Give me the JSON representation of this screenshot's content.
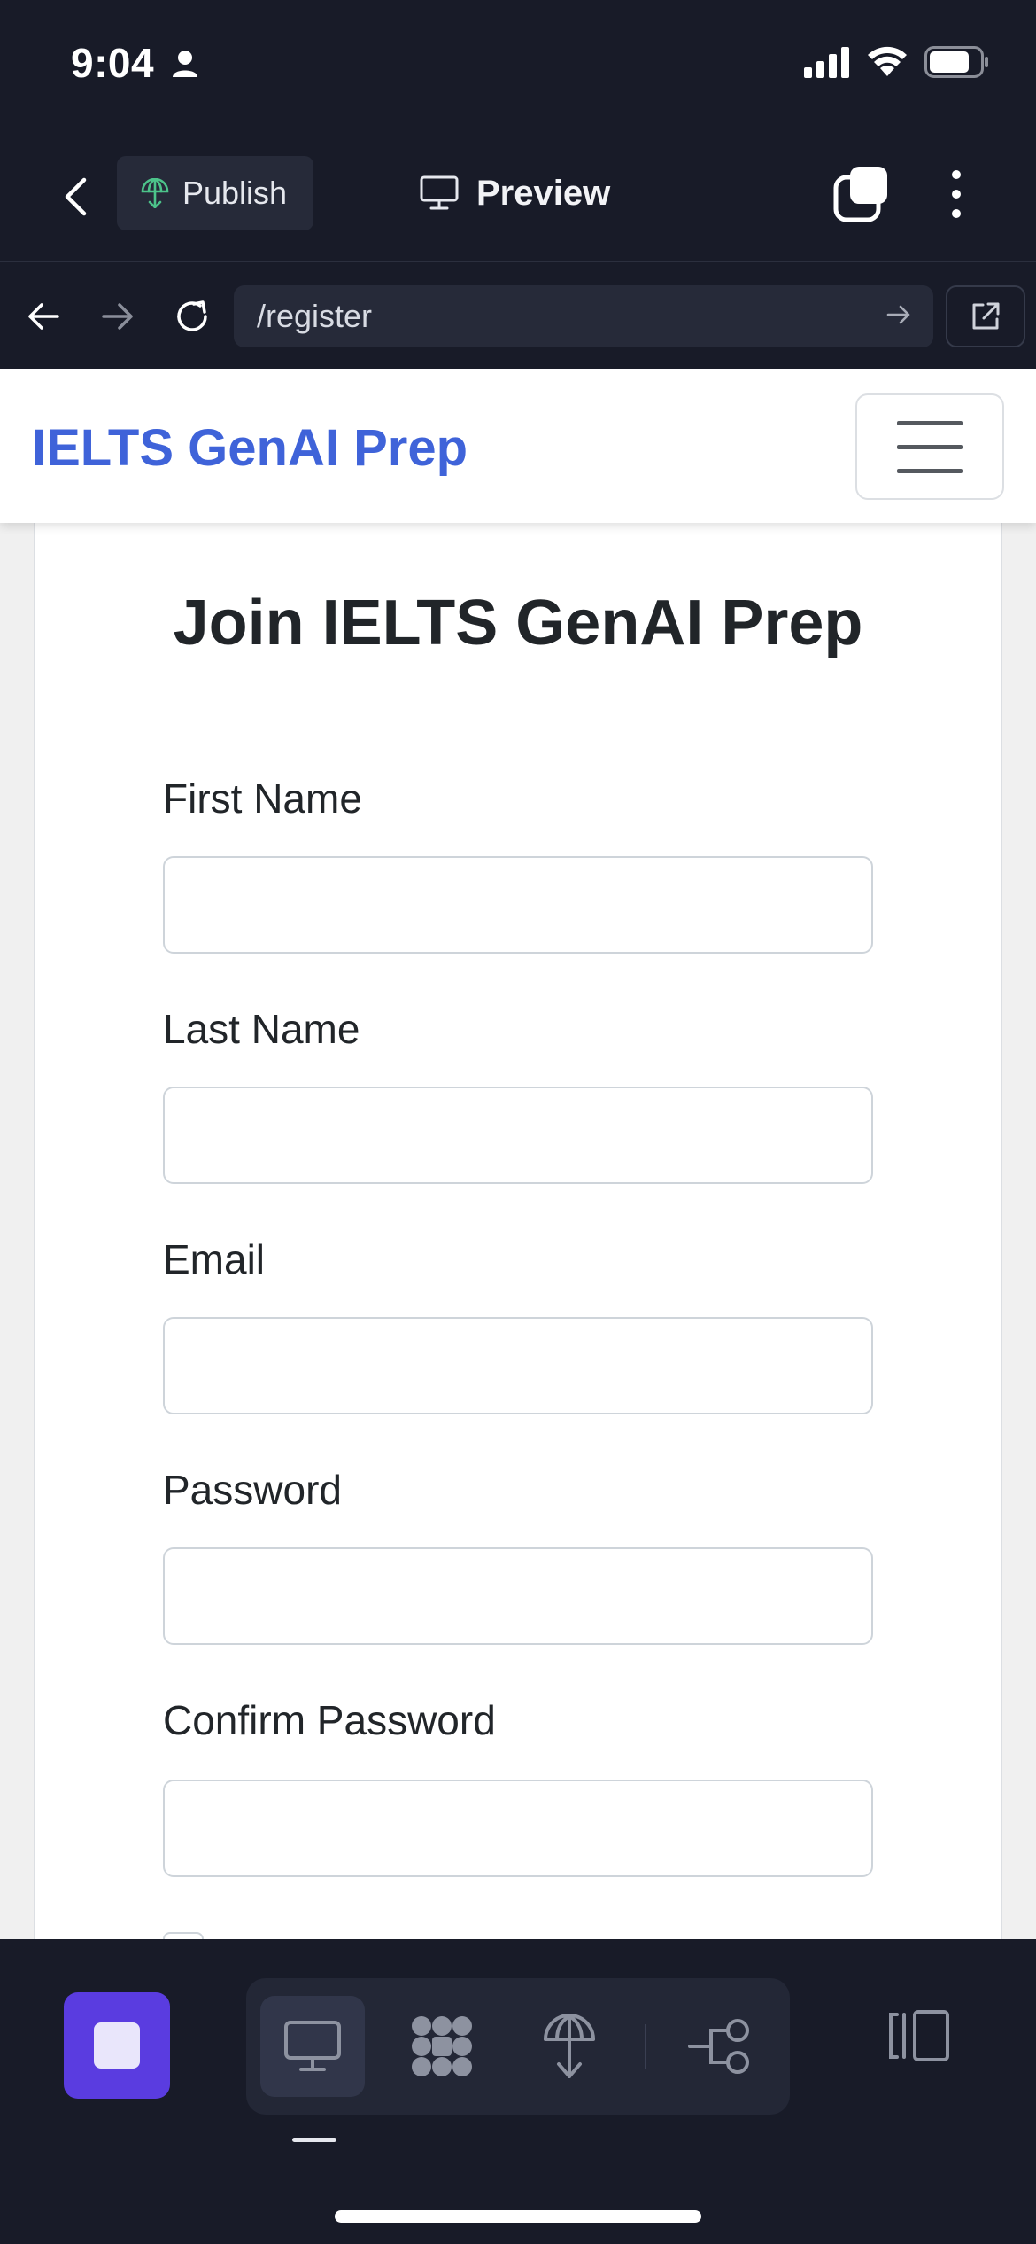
{
  "status_bar": {
    "time": "9:04"
  },
  "editor_bar": {
    "publish_label": "Publish",
    "preview_label": "Preview"
  },
  "browser": {
    "url": "/register"
  },
  "site": {
    "brand": "IELTS GenAI Prep",
    "form_title": "Join IELTS GenAI Prep",
    "fields": [
      {
        "label": "First Name",
        "value": ""
      },
      {
        "label": "Last Name",
        "value": ""
      },
      {
        "label": "Email",
        "value": ""
      },
      {
        "label": "Password",
        "value": ""
      },
      {
        "label": "Confirm Password",
        "value": ""
      }
    ]
  },
  "colors": {
    "brand": "#3f63d9",
    "stop_button": "#5a3ce0",
    "publish_icon": "#4cc38a"
  },
  "icons": {
    "status": [
      "person-icon",
      "signal-icon",
      "wifi-icon",
      "battery-icon"
    ],
    "toolbar": [
      "desktop-icon",
      "components-icon",
      "publish-icon",
      "workflow-icon",
      "panel-icon"
    ]
  }
}
